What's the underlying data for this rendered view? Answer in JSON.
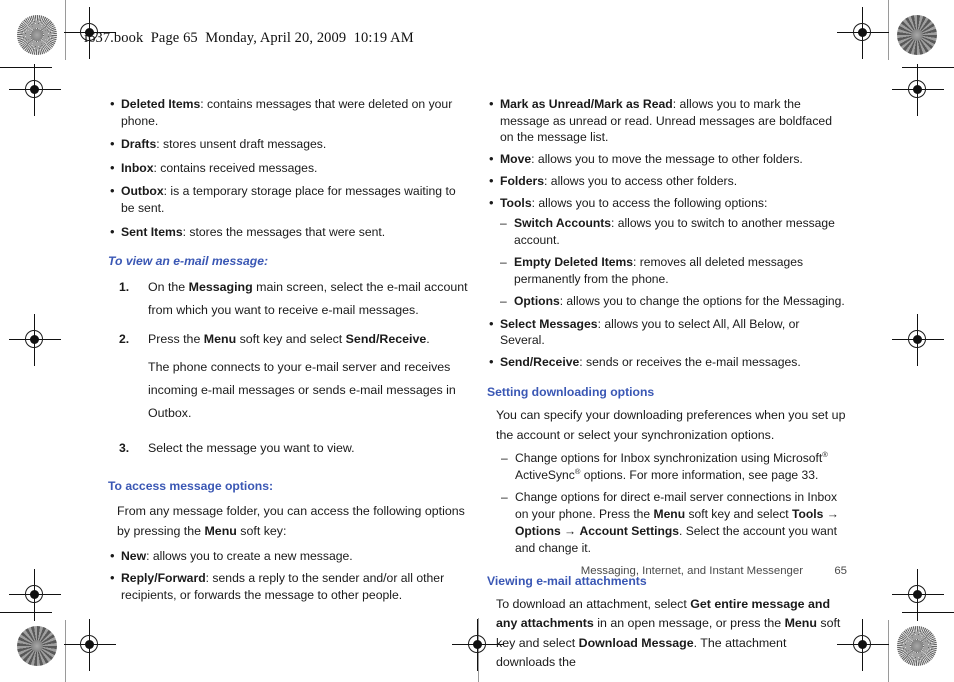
{
  "header": {
    "slug": "i637.book  Page 65  Monday, April 20, 2009  10:19 AM"
  },
  "colors": {
    "heading_blue": "#3a57b4",
    "body_text": "#1a1a1a",
    "footer_text": "#4a4a4a"
  },
  "left_column": {
    "folder_list": [
      {
        "term": "Deleted Items",
        "desc": ": contains messages that were deleted on your phone."
      },
      {
        "term": "Drafts",
        "desc": ": stores unsent draft messages."
      },
      {
        "term": "Inbox",
        "desc": ": contains received messages."
      },
      {
        "term": "Outbox",
        "desc": ": is a temporary storage place for messages waiting to be sent."
      },
      {
        "term": "Sent Items",
        "desc": ": stores the messages that were sent."
      }
    ],
    "view_heading": "To view an e-mail message:",
    "steps": [
      {
        "num": "1.",
        "pre": "On the ",
        "b1": "Messaging",
        "post": " main screen, select the e-mail account from which you want to receive e-mail messages."
      },
      {
        "num": "2.",
        "pre": "Press the ",
        "b1": "Menu",
        "mid": " soft key and select ",
        "b2": "Send/Receive",
        "post": "."
      },
      {
        "num": "3.",
        "pre": "Select the message you want to view.",
        "b1": "",
        "post": ""
      }
    ],
    "step2_note": "The phone connects to your e-mail server and receives incoming e-mail messages or sends e-mail messages in Outbox.",
    "options_heading": "To access message options:",
    "options_intro_a": "From any message folder, you can access the following options by pressing the ",
    "options_intro_b": "Menu",
    "options_intro_c": " soft key:",
    "options_list": [
      {
        "term": "New",
        "desc": ": allows you to create a new message."
      },
      {
        "term": "Reply/Forward",
        "desc": ": sends a reply to the sender and/or all other recipients, or forwards the message to other people."
      }
    ]
  },
  "right_column": {
    "options_list": [
      {
        "term": "Mark as Unread/Mark as Read",
        "desc": ": allows you to mark the message as unread or read. Unread messages are boldfaced on the message list."
      },
      {
        "term": "Move",
        "desc": ": allows you to move the message to other folders."
      },
      {
        "term": "Folders",
        "desc": ": allows you to access other folders."
      },
      {
        "term": "Tools",
        "desc": ": allows you to access the following options:"
      }
    ],
    "tools_sublist": [
      {
        "term": "Switch Accounts",
        "desc": ": allows you to switch to another message account."
      },
      {
        "term": "Empty Deleted Items",
        "desc": ": removes all deleted messages permanently from the phone."
      },
      {
        "term": "Options",
        "desc": ": allows you to change the options for the Messaging."
      }
    ],
    "options_list_cont": [
      {
        "term": "Select Messages",
        "desc": ": allows you to select All, All Below, or Several."
      },
      {
        "term": "Send/Receive",
        "desc": ": sends or receives the e-mail messages."
      }
    ],
    "download_heading": "Setting downloading options",
    "download_intro": "You can specify your downloading preferences when you set up the account or select your synchronization options.",
    "download_items": [
      {
        "text_a": "Change options for Inbox synchronization using Microsoft",
        "sup_a": "®",
        "text_b": " ActiveSync",
        "sup_b": "®",
        "text_c": " options. For more information, see page 33."
      }
    ],
    "download_item2": {
      "pre": "Change options for direct e-mail server connections in Inbox on your phone. Press the ",
      "b1": "Menu",
      "mid1": " soft key and select ",
      "b2": "Tools",
      "arrow1": " → ",
      "b3": "Options",
      "arrow2": " → ",
      "b4": "Account Settings",
      "post": ". Select the account you want and change it."
    },
    "attach_heading": "Viewing e-mail attachments",
    "attach_para": {
      "pre": "To download an attachment, select ",
      "b1": "Get entire message and any attachments",
      "mid1": " in an open message, or press the ",
      "b2": "Menu",
      "mid2": " soft key and select ",
      "b3": "Download Message",
      "post": ". The attachment downloads the"
    }
  },
  "footer": {
    "chapter": "Messaging, Internet, and Instant Messenger",
    "page_number": "65"
  }
}
